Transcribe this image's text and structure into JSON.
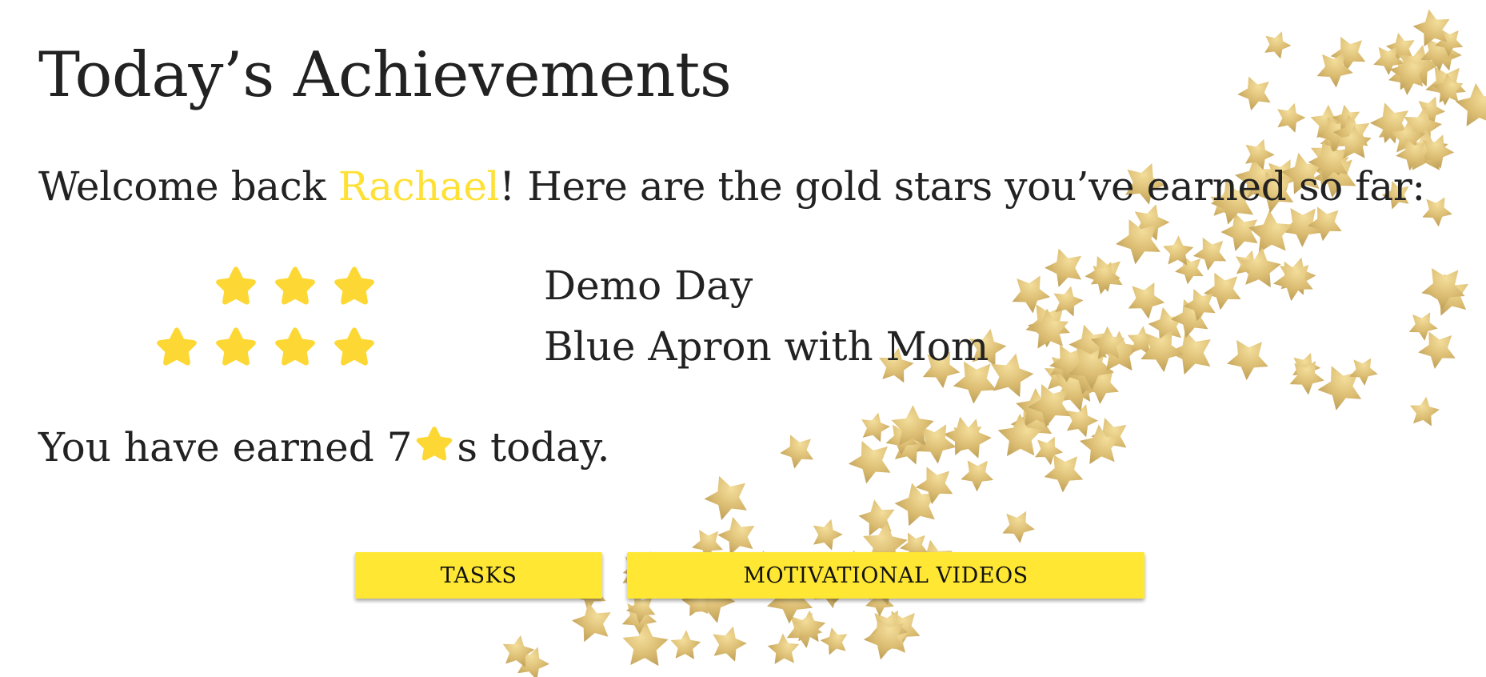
{
  "header": {
    "title": "Today’s Achievements"
  },
  "welcome": {
    "prefix": "Welcome back ",
    "name": "Rachael",
    "suffix": "! Here are the gold stars you’ve earned so far:"
  },
  "achievements": [
    {
      "label": "Demo Day",
      "stars": 3
    },
    {
      "label": "Blue Apron with Mom",
      "stars": 4
    }
  ],
  "summary": {
    "prefix": "You have earned 7",
    "suffix": "s today."
  },
  "buttons": {
    "tasks_label": "TASKS",
    "videos_label": "MOTIVATIONAL VIDEOS"
  },
  "colors": {
    "accent_yellow": "#FFE034",
    "star_yellow": "#FDD835",
    "button_yellow": "#FFE733",
    "text": "#222222",
    "background_star_gold": "#D9B75F"
  },
  "icons": {
    "achievement_star": "star-icon",
    "background": "gold-star-confetti"
  }
}
